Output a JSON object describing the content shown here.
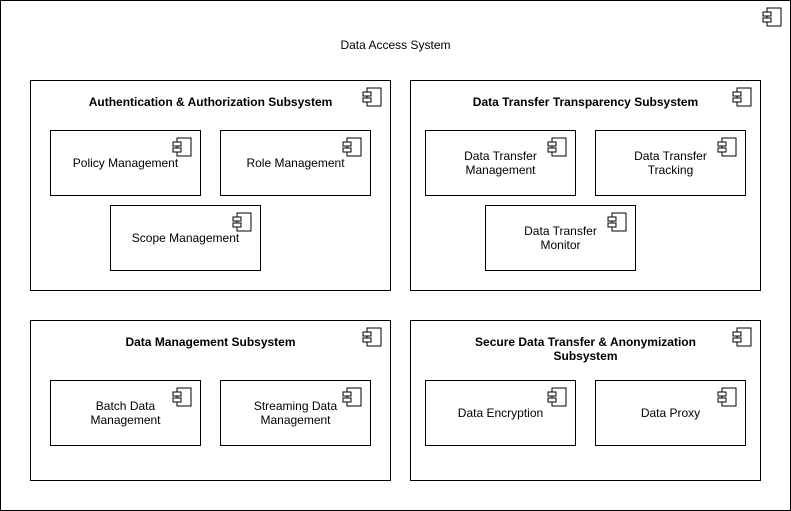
{
  "system": {
    "title": "Data Access System",
    "icon": "uml-component-icon"
  },
  "subsystems": [
    {
      "title": "Authentication & Authorization Subsystem",
      "icon": "uml-component-icon",
      "components": [
        {
          "label": "Policy Management",
          "icon": "uml-component-icon"
        },
        {
          "label": "Role Management",
          "icon": "uml-component-icon"
        },
        {
          "label": "Scope Management",
          "icon": "uml-component-icon"
        }
      ]
    },
    {
      "title": "Data Transfer Transparency Subsystem",
      "icon": "uml-component-icon",
      "components": [
        {
          "label": "Data Transfer\nManagement",
          "icon": "uml-component-icon"
        },
        {
          "label": "Data Transfer\nTracking",
          "icon": "uml-component-icon"
        },
        {
          "label": "Data Transfer\nMonitor",
          "icon": "uml-component-icon"
        }
      ]
    },
    {
      "title": "Data Management Subsystem",
      "icon": "uml-component-icon",
      "components": [
        {
          "label": "Batch Data\nManagement",
          "icon": "uml-component-icon"
        },
        {
          "label": "Streaming Data\nManagement",
          "icon": "uml-component-icon"
        }
      ]
    },
    {
      "title": "Secure Data Transfer & Anonymization\nSubsystem",
      "icon": "uml-component-icon",
      "components": [
        {
          "label": "Data Encryption",
          "icon": "uml-component-icon"
        },
        {
          "label": "Data Proxy",
          "icon": "uml-component-icon"
        }
      ]
    }
  ]
}
